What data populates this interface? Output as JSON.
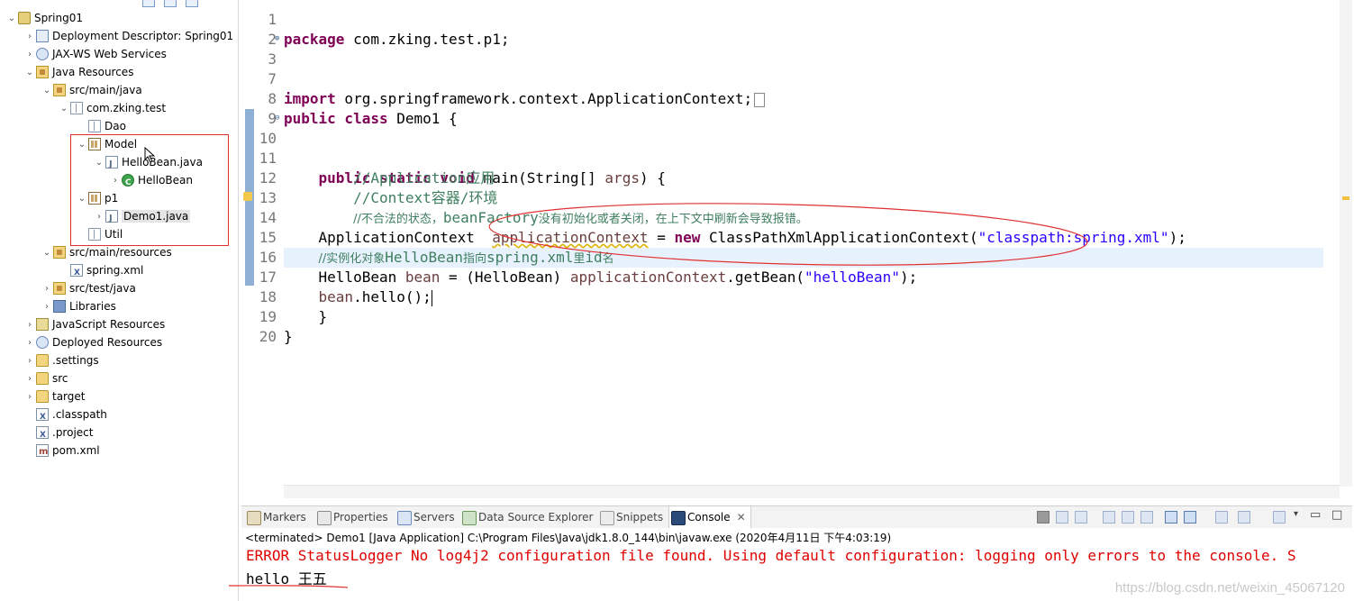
{
  "explorer": {
    "items": [
      {
        "label": "Spring01",
        "icon": "project-icon"
      },
      {
        "label": "Deployment Descriptor: Spring01",
        "icon": "deployment-descriptor-icon"
      },
      {
        "label": "JAX-WS Web Services",
        "icon": "web-services-icon"
      },
      {
        "label": "Java Resources",
        "icon": "java-resources-icon"
      },
      {
        "label": "src/main/java",
        "icon": "source-folder-icon"
      },
      {
        "label": "com.zking.test",
        "icon": "package-icon"
      },
      {
        "label": "Dao",
        "icon": "package-icon"
      },
      {
        "label": "Model",
        "icon": "package-icon"
      },
      {
        "label": "HelloBean.java",
        "icon": "java-file-icon"
      },
      {
        "label": "HelloBean",
        "icon": "class-icon"
      },
      {
        "label": "p1",
        "icon": "package-icon"
      },
      {
        "label": "Demo1.java",
        "icon": "java-file-icon"
      },
      {
        "label": "Util",
        "icon": "package-icon"
      },
      {
        "label": "src/main/resources",
        "icon": "source-folder-icon"
      },
      {
        "label": "spring.xml",
        "icon": "xml-file-icon"
      },
      {
        "label": "src/test/java",
        "icon": "source-folder-icon"
      },
      {
        "label": "Libraries",
        "icon": "libraries-icon"
      },
      {
        "label": "JavaScript Resources",
        "icon": "javascript-resources-icon"
      },
      {
        "label": "Deployed Resources",
        "icon": "deployed-resources-icon"
      },
      {
        "label": ".settings",
        "icon": "folder-icon"
      },
      {
        "label": "src",
        "icon": "folder-icon"
      },
      {
        "label": "target",
        "icon": "folder-icon"
      },
      {
        "label": ".classpath",
        "icon": "xml-file-icon"
      },
      {
        "label": ".project",
        "icon": "xml-file-icon"
      },
      {
        "label": "pom.xml",
        "icon": "maven-file-icon"
      }
    ]
  },
  "editor": {
    "line_numbers": [
      "1",
      "2",
      "3",
      "7",
      "8",
      "9",
      "10",
      "11",
      "12",
      "13",
      "14",
      "15",
      "16",
      "17",
      "18",
      "19",
      "20"
    ],
    "code": {
      "l1_kw": "package",
      "l1_rest": " com.zking.test.p1;",
      "l3_kw": "import",
      "l3_rest": " org.springframework.context.ApplicationContext;",
      "l8_kw": "public class",
      "l8_rest": " Demo1 {",
      "l10_kw": "public static void",
      "l10_rest": " main(String[] ",
      "l10_var": "args",
      "l10_end": ") {",
      "l11": "//Application应用",
      "l12": "//Context容器/环境",
      "l13a": "//不合法的状态，",
      "l13b": "beanFactory",
      "l13c": "没有初始化或者关闭，在上下文中刷新会导致报错。",
      "l14_a": "ApplicationContext  ",
      "l14_var": "applicationContext",
      "l14_b": " = ",
      "l14_kw": "new",
      "l14_c": " ClassPathXmlApplicationContext(",
      "l14_str": "\"classpath:spring.xml\"",
      "l14_d": ");",
      "l15a": "//实例化对象",
      "l15b": "HelloBean",
      "l15c": "指向",
      "l15d": "spring.xml",
      "l15e": "里",
      "l15f": "id",
      "l15g": "名",
      "l16_a": "HelloBean ",
      "l16_var": "bean",
      "l16_b": " = (HelloBean) ",
      "l16_var2": "applicationContext",
      "l16_c": ".getBean(",
      "l16_str": "\"helloBean\"",
      "l16_d": ");",
      "l17_var": "bean",
      "l17_rest": ".hello();",
      "l18": "}",
      "l19": "}"
    }
  },
  "console": {
    "tabs": [
      {
        "label": "Markers",
        "icon": "markers-icon"
      },
      {
        "label": "Properties",
        "icon": "properties-icon"
      },
      {
        "label": "Servers",
        "icon": "servers-icon"
      },
      {
        "label": "Data Source Explorer",
        "icon": "data-source-icon"
      },
      {
        "label": "Snippets",
        "icon": "snippets-icon"
      },
      {
        "label": "Console",
        "icon": "console-icon"
      }
    ],
    "terminated": "<terminated> Demo1 [Java Application] C:\\Program Files\\Java\\jdk1.8.0_144\\bin\\javaw.exe (2020年4月11日 下午4:03:19)",
    "error_line": "ERROR StatusLogger No log4j2 configuration file found. Using default configuration: logging only errors to the console. S",
    "output_line": "hello 王五",
    "watermark": "https://blog.csdn.net/weixin_45067120"
  },
  "colors": {
    "keyword": "#7f0055",
    "comment": "#3f7f5f",
    "string": "#2a00ff",
    "variable": "#6a3e3e",
    "error": "#e00000",
    "annotation_red": "#e03030"
  }
}
